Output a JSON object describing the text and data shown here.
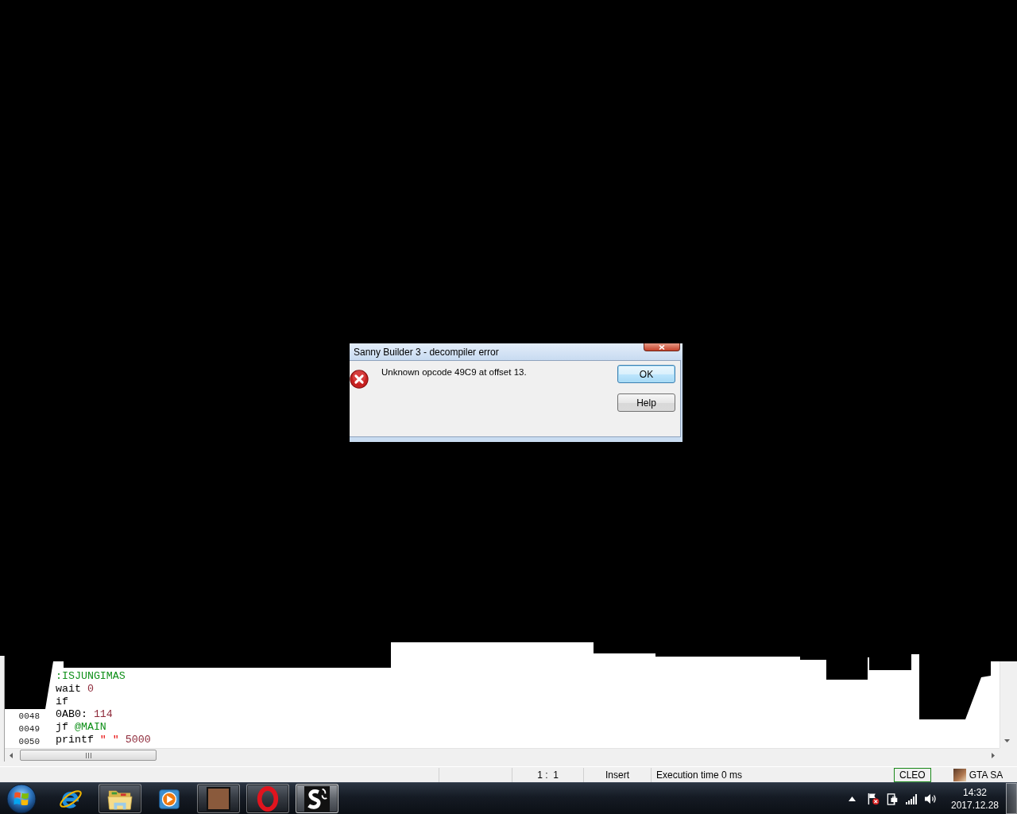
{
  "dialog": {
    "title": "Sanny Builder 3 - decompiler error",
    "message": "Unknown opcode 49C9 at offset 13.",
    "buttons": [
      {
        "label": "OK",
        "default": true
      },
      {
        "label": "Help",
        "default": false
      }
    ]
  },
  "editor": {
    "lines": [
      {
        "tokens": [
          {
            "text": ":ISJUNGIMAS",
            "kind": "label"
          }
        ]
      },
      {
        "tokens": [
          {
            "text": "wait",
            "kind": "command"
          },
          {
            "text": "0",
            "kind": "number"
          }
        ]
      },
      {
        "tokens": [
          {
            "text": "if",
            "kind": "command"
          }
        ]
      },
      {
        "number": "0048",
        "tokens": [
          {
            "text": "0AB0:",
            "kind": "command"
          },
          {
            "text": "114",
            "kind": "number"
          }
        ]
      },
      {
        "number": "0049",
        "tokens": [
          {
            "text": "jf",
            "kind": "command"
          },
          {
            "text": "@MAIN",
            "kind": "label"
          }
        ]
      },
      {
        "number": "0050",
        "tokens": [
          {
            "text": "printf",
            "kind": "command"
          },
          {
            "text": "\" \"",
            "kind": "string"
          },
          {
            "text": "5000",
            "kind": "number"
          }
        ]
      }
    ]
  },
  "status_bar": {
    "cursor": "1 :  1",
    "mode": "Insert",
    "message": "Execution time 0 ms",
    "badge": "CLEO",
    "game": "GTA SA"
  },
  "taskbar": {
    "items": [
      {
        "kind": "browser",
        "running": false,
        "active": false
      },
      {
        "kind": "folder",
        "running": true,
        "active": false
      },
      {
        "kind": "media",
        "running": false,
        "active": false
      },
      {
        "kind": "game",
        "running": true,
        "active": false
      },
      {
        "kind": "opera",
        "running": true,
        "active": false
      },
      {
        "kind": "editor",
        "running": true,
        "active": true
      }
    ],
    "clock": {
      "time": "14:32",
      "date": "2017.12.28"
    }
  }
}
